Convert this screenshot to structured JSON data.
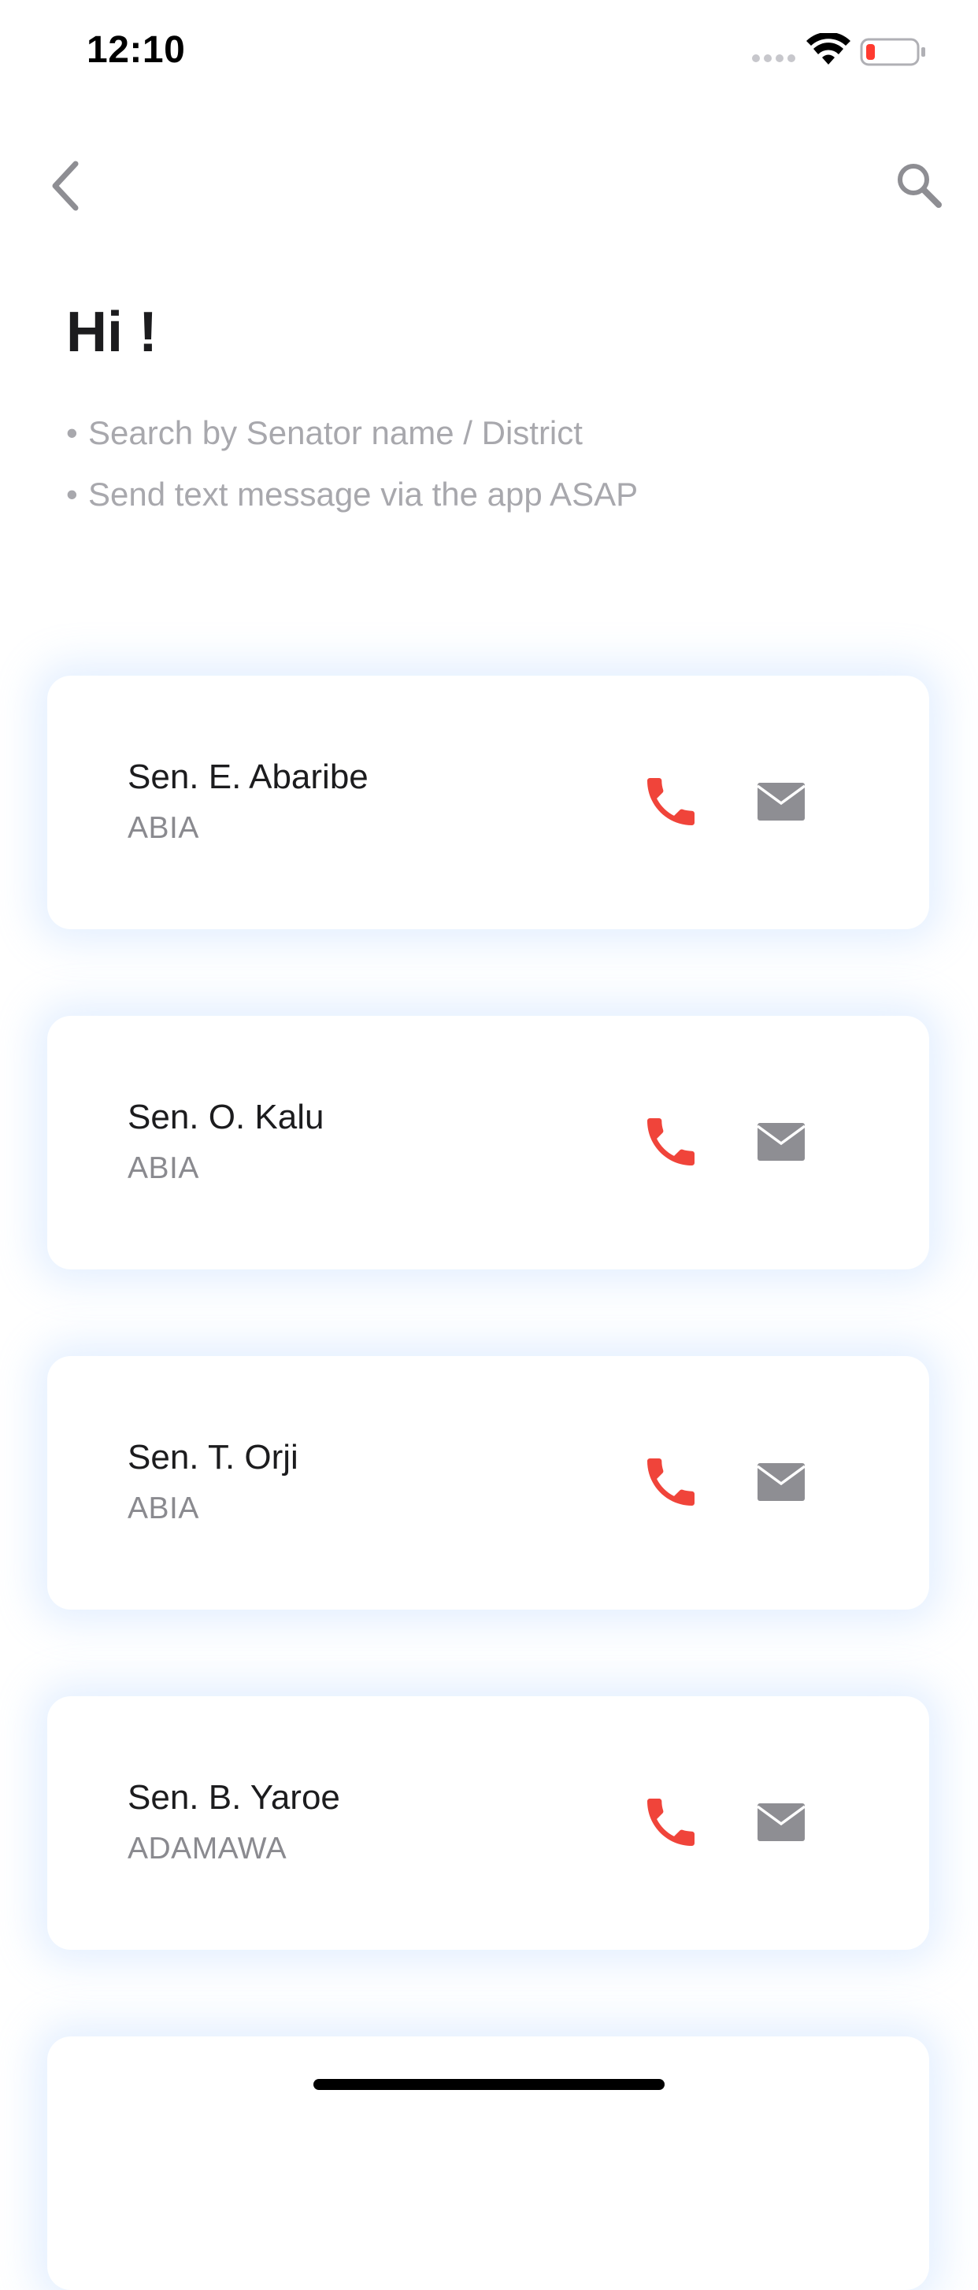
{
  "status_bar": {
    "time": "12:10",
    "signal_icon": "signal-dots-icon",
    "wifi_icon": "wifi-icon",
    "battery_icon": "battery-low-icon",
    "battery_color": "#ff3b30"
  },
  "nav": {
    "back_icon": "chevron-left-icon",
    "search_icon": "search-icon",
    "icon_color": "#8e8e93"
  },
  "header": {
    "greeting": "Hi !",
    "hints": [
      "Search by Senator name / District",
      "Send text message via the app ASAP"
    ]
  },
  "senators": [
    {
      "name": "Sen. E. Abaribe",
      "district": "ABIA"
    },
    {
      "name": "Sen. O. Kalu",
      "district": "ABIA"
    },
    {
      "name": "Sen. T. Orji",
      "district": "ABIA"
    },
    {
      "name": "Sen. B. Yaroe",
      "district": "ADAMAWA"
    },
    {
      "name": "",
      "district": ""
    }
  ],
  "actions": {
    "call_icon": "phone-icon",
    "call_color": "#f0443a",
    "mail_icon": "envelope-icon",
    "mail_color": "#8e8e93"
  }
}
